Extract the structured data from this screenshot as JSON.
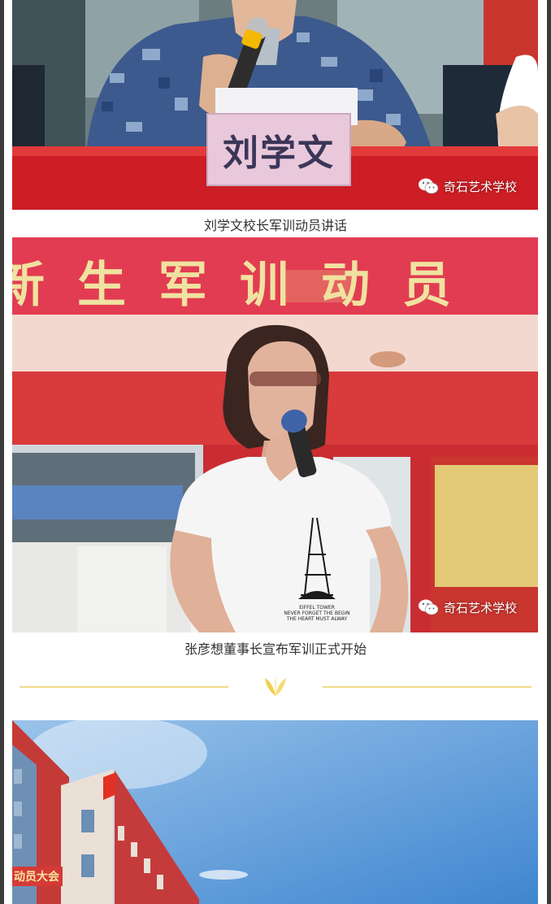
{
  "photos": [
    {
      "sign_text": "刘学文",
      "watermark": "奇石艺术学校",
      "caption": "刘学文校长军训动员讲话"
    },
    {
      "banner_text": "新生军训动员",
      "shirt_text": [
        "EIFFEL TOWER",
        "NEVER FORGET THE BEGIN",
        "THE HEART MUST ALWAY"
      ],
      "watermark": "奇石艺术学校",
      "caption": "张彦想董事长宣布军训正式开始"
    },
    {
      "building_banner": "动员大会"
    }
  ],
  "colors": {
    "caption_text": "#333333",
    "divider": "#f1d98a",
    "accent_gold": "#f0c040",
    "table_red": "#d11f2a"
  }
}
